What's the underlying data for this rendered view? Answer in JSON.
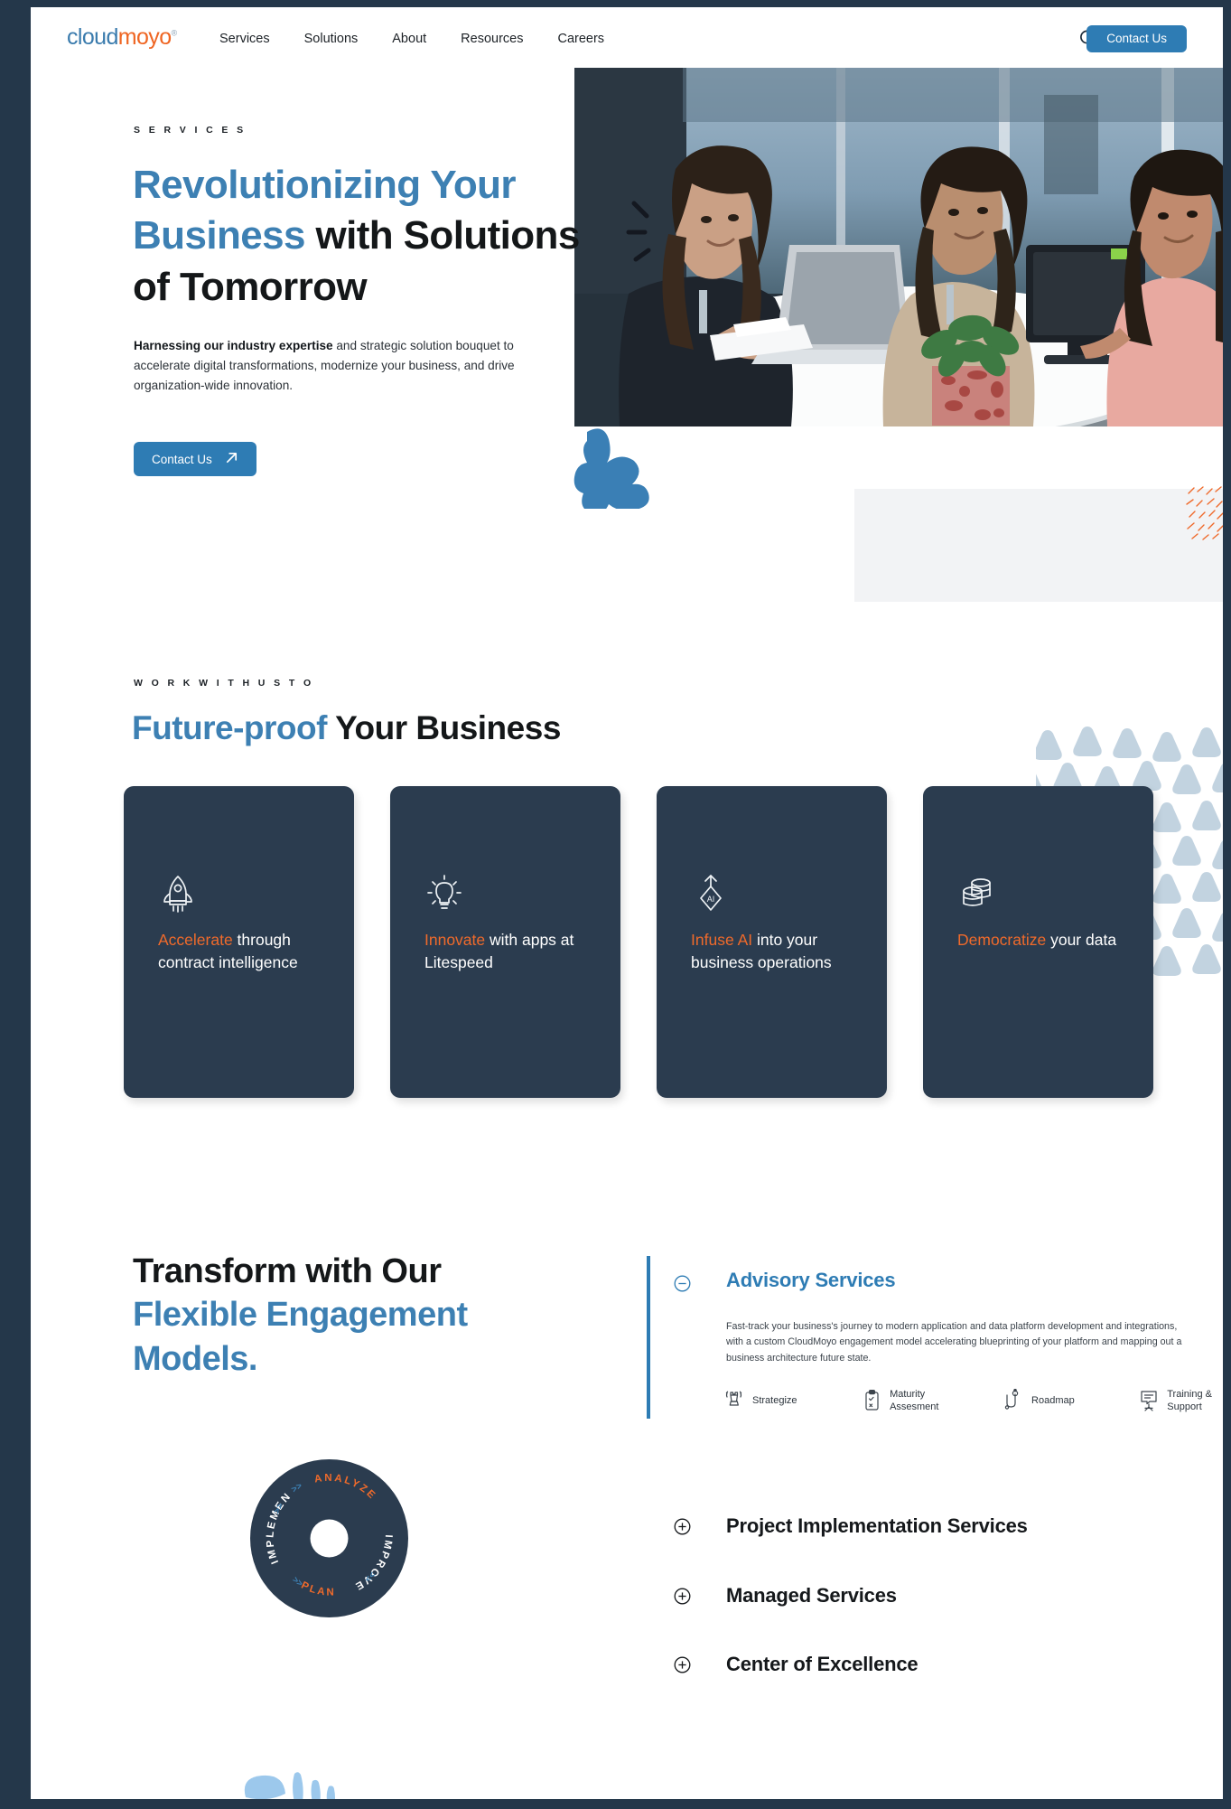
{
  "brand": {
    "logo_part1": "cloud",
    "logo_part2": "moyo",
    "logo_tm": "®",
    "accent_blue": "#2e7cb4",
    "accent_orange": "#ef6a2b",
    "dark_navy": "#2b3c4f"
  },
  "header": {
    "nav": [
      {
        "label": "Services",
        "name": "nav-services"
      },
      {
        "label": "Solutions",
        "name": "nav-solutions"
      },
      {
        "label": "About",
        "name": "nav-about"
      },
      {
        "label": "Resources",
        "name": "nav-resources"
      },
      {
        "label": "Careers",
        "name": "nav-careers"
      }
    ],
    "search_icon": "search-icon",
    "contact_label": "Contact Us"
  },
  "hero": {
    "eyebrow": "S E R V I C E S",
    "title_line1_blue": "Revolutionizing Your",
    "title_line2_blue": "Business",
    "title_line2_rest": " with Solutions",
    "title_line3": "of Tomorrow",
    "sub_bold": "Harnessing our industry expertise",
    "sub_rest": " and strategic solution bouquet to accelerate digital transformations, modernize your business, and drive organization-wide innovation.",
    "cta_label": "Contact Us",
    "cta_icon": "arrow-up-right-icon"
  },
  "future_proof": {
    "eyebrow": "W O R K   W I T H   U S   T O",
    "title_blue": "Future-proof",
    "title_rest": " Your Business",
    "cards": [
      {
        "icon": "rocket-icon",
        "highlight": "Accelerate",
        "rest": " through contract intelligence",
        "name": "card-accelerate"
      },
      {
        "icon": "lightbulb-icon",
        "highlight": "Innovate",
        "rest": " with apps at Litespeed",
        "name": "card-innovate"
      },
      {
        "icon": "ai-diamond-arrow-icon",
        "highlight": "Infuse AI",
        "rest": " into your business operations",
        "name": "card-infuse-ai"
      },
      {
        "icon": "database-icon",
        "highlight": "Democratize",
        "rest": " your data",
        "name": "card-democratize"
      }
    ]
  },
  "transform": {
    "title_line1": "Transform with Our",
    "title_line2_blue": "Flexible Engagement",
    "title_line3_blue": "Models.",
    "wheel": {
      "segments": [
        "ANALYZE",
        "IMPROVE",
        "PLAN",
        "IMPLEMENT"
      ],
      "arrow_marks": [
        ">>",
        ">>",
        "<<",
        "<<"
      ]
    },
    "accordion": [
      {
        "name": "accordion-advisory-services",
        "state": "expanded",
        "toggle_icon": "minus-circle-icon",
        "title": "Advisory Services",
        "body": "Fast-track your business's journey to modern application and data platform development and integrations, with a custom CloudMoyo engagement model accelerating blueprinting of your platform and mapping out a business architecture future state.",
        "features": [
          {
            "icon": "chess-rook-icon",
            "label": "Strategize"
          },
          {
            "icon": "clipboard-check-icon",
            "label": "Maturity\nAssesment"
          },
          {
            "icon": "roadmap-pin-icon",
            "label": "Roadmap"
          },
          {
            "icon": "flipchart-icon",
            "label": "Training &\nSupport"
          }
        ]
      },
      {
        "name": "accordion-project-implementation-services",
        "state": "collapsed",
        "toggle_icon": "plus-circle-icon",
        "title": "Project Implementation Services"
      },
      {
        "name": "accordion-managed-services",
        "state": "collapsed",
        "toggle_icon": "plus-circle-icon",
        "title": "Managed Services"
      },
      {
        "name": "accordion-center-of-excellence",
        "state": "collapsed",
        "toggle_icon": "plus-circle-icon",
        "title": "Center of Excellence"
      }
    ]
  }
}
